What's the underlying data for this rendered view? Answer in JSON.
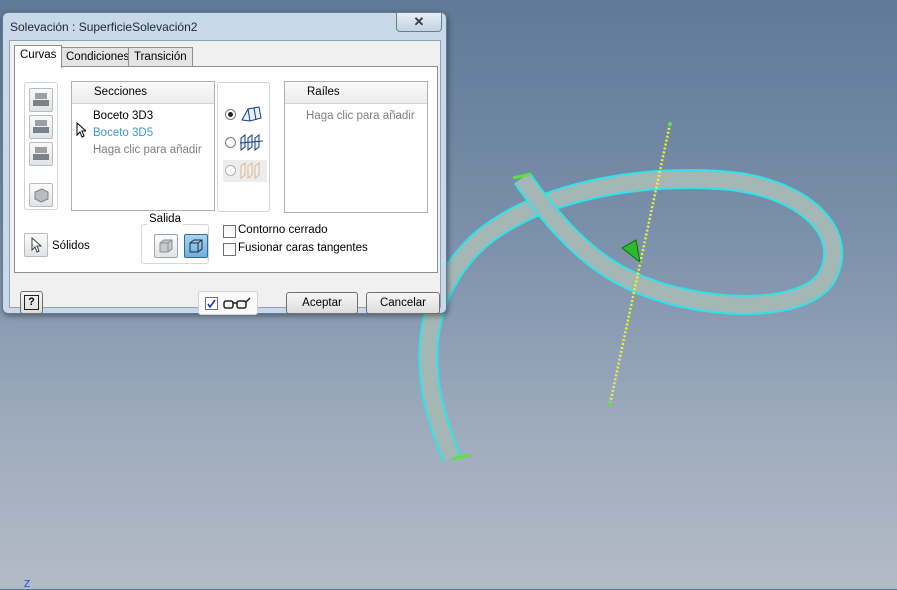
{
  "dialog": {
    "title": "Solevación : SuperficieSolevación2",
    "close_glyph": "✕",
    "tabs": [
      {
        "label": "Curvas",
        "active": true
      },
      {
        "label": "Condiciones",
        "active": false
      },
      {
        "label": "Transición",
        "active": false
      }
    ],
    "left_buttons": [
      "sketch-icon",
      "sketch-icon",
      "sketch-icon",
      "solid-icon"
    ],
    "sections": {
      "header": "Secciones",
      "items": [
        {
          "label": "Boceto 3D3",
          "highlight": false
        },
        {
          "label": "Boceto 3D5",
          "highlight": true
        },
        {
          "label": "Haga clic para añadir",
          "highlight": false
        }
      ]
    },
    "mode_options": [
      {
        "icon": "rails-mode-icon",
        "selected": true,
        "enabled": true
      },
      {
        "icon": "centerline-mode-icon",
        "selected": false,
        "enabled": true
      },
      {
        "icon": "area-mode-icon",
        "selected": false,
        "enabled": false
      }
    ],
    "rails": {
      "header": "Raíles",
      "placeholder": "Haga clic para añadir"
    },
    "solids_label": "Sólidos",
    "output": {
      "label": "Salida",
      "options": [
        {
          "icon": "solid-box-icon",
          "selected": false
        },
        {
          "icon": "surface-box-icon",
          "selected": true
        }
      ]
    },
    "checkboxes": [
      {
        "label": "Contorno cerrado",
        "checked": false
      },
      {
        "label": "Fusionar caras tangentes",
        "checked": false
      }
    ],
    "help_glyph": "?",
    "preview_checked": true,
    "preview_icon": "glasses-icon",
    "accept_label": "Aceptar",
    "cancel_label": "Cancelar"
  },
  "viewport": {
    "axis_label": "Z",
    "colors": {
      "surface": "#a5b7b5",
      "edge": "#2fe3ea",
      "rail_points": "#5ce04a",
      "axis_line": "#e8f032"
    }
  }
}
